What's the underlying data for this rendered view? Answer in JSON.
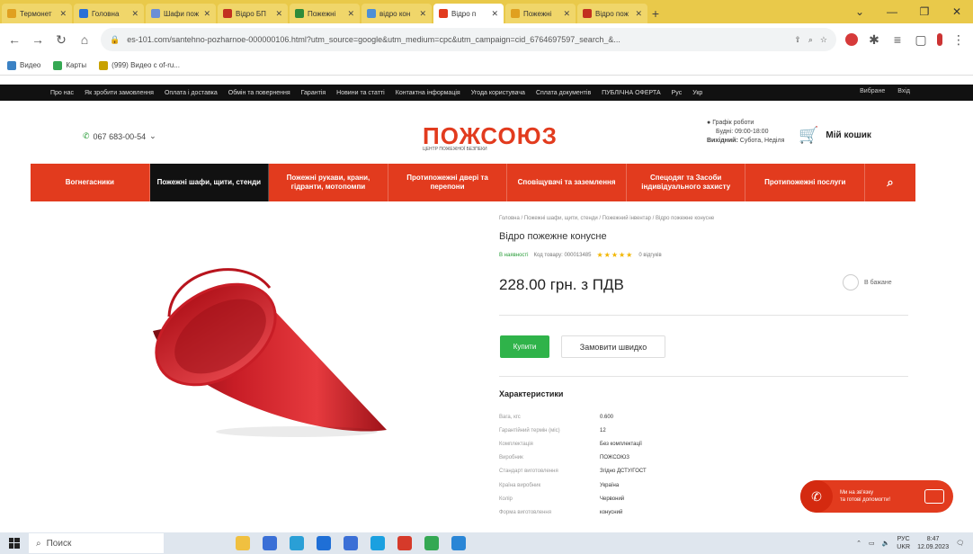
{
  "browser": {
    "tabs": [
      {
        "label": "Термонет",
        "color": "#e0a020"
      },
      {
        "label": "Головна",
        "color": "#2a6fd6"
      },
      {
        "label": "Шафи пож",
        "color": "#6b8fd6"
      },
      {
        "label": "Відро БП",
        "color": "#c23020"
      },
      {
        "label": "Пожежні",
        "color": "#2e8b3a"
      },
      {
        "label": "відро кон",
        "color": "#4c8fd6"
      },
      {
        "label": "Відро п",
        "color": "#e23b1e",
        "active": true
      },
      {
        "label": "Пожежні",
        "color": "#e0a020"
      },
      {
        "label": "Відро пож",
        "color": "#c23020"
      }
    ],
    "new_tab": "+",
    "url": "es-101.com/santehno-pozharnoe-000000106.html?utm_source=google&utm_medium=cpc&utm_campaign=cid_6764697597_search_&...",
    "bookmarks": [
      {
        "label": "Видео",
        "color": "#3b82c4"
      },
      {
        "label": "Карты",
        "color": "#35a853"
      },
      {
        "label": "(999) Видео с of-ru...",
        "color": "#c8a100"
      }
    ]
  },
  "site": {
    "topbar_links": [
      "Про нас",
      "Як зробити замовлення",
      "Оплата і доставка",
      "Обмін та повернення",
      "Гарантія",
      "Новини та статті",
      "Контактна інформація",
      "Угода користувача",
      "Сплата документів",
      "ПУБЛІЧНА ОФЕРТА",
      "Рус",
      "Укр"
    ],
    "topbar_right": [
      "Вибране",
      "Вхід"
    ],
    "phone": "067 683-00-54",
    "logo_text": "ПОЖСОЮЗ",
    "logo_sub": "ЦЕНТР ПОЖЕЖНОЇ БЕЗПЕКИ",
    "hours": {
      "title": "Графік роботи",
      "weekdays": "Будні: 09:00-18:00",
      "weekend_label": "Вихідний:",
      "weekend": "Субота, Неділя"
    },
    "cart_label": "Мій кошик",
    "categories": [
      {
        "label": "Вогнегасники"
      },
      {
        "label": "Пожежні шафи, щити, стенди",
        "active": true
      },
      {
        "label": "Пожежні рукави, крани, гідранти, мотопомпи"
      },
      {
        "label": "Протипожежні двері та перепони"
      },
      {
        "label": "Сповіщувачі та заземлення"
      },
      {
        "label": "Спецодяг та Засоби індивідуального захисту"
      },
      {
        "label": "Протипожежні послуги"
      }
    ],
    "search_icon": "search-icon"
  },
  "product": {
    "breadcrumbs": "Головна  /  Пожежні шафи, щити, стенди  /  Пожежний інвентар  /  Відро пожежне конусне",
    "title": "Відро пожежне конусне",
    "in_stock": "В наявності",
    "sku": "Код товару: 000013485",
    "stars": "★★★★★",
    "reviews": "0 відгуків",
    "price": "228.00 грн. з ПДВ",
    "favorite": "В бажане",
    "buy_label": "Купити",
    "quick_order_label": "Замовити швидко",
    "specs_title": "Характеристики",
    "specs": [
      {
        "k": "Вага, кгс",
        "v": "0.600"
      },
      {
        "k": "Гарантійний термін (міс)",
        "v": "12"
      },
      {
        "k": "Комплектація",
        "v": "Без комплектації"
      },
      {
        "k": "Виробник",
        "v": "ПОЖСОЮЗ"
      },
      {
        "k": "Стандарт виготовлення",
        "v": "Згідно ДСТУ/ГОСТ"
      },
      {
        "k": "Країна виробник",
        "v": "Україна"
      },
      {
        "k": "Колір",
        "v": "Червоний"
      },
      {
        "k": "Форма виготовлення",
        "v": "конусний"
      }
    ],
    "bucket_color": "#d4202a"
  },
  "callback": {
    "text_line1": "Ми на зв'язку",
    "text_line2": "та готові допомогти!"
  },
  "taskbar": {
    "search_placeholder": "Поиск",
    "lang": "РУС",
    "lang2": "UKR",
    "time": "8:47",
    "date": "12.09.2023",
    "apps": [
      "#f0c040",
      "#3a6fd6",
      "#2a9fd6",
      "#1f6fd6",
      "#3b6fd6",
      "#1aa0e0",
      "#d63a2a",
      "#34a853",
      "#2a86d6"
    ]
  }
}
